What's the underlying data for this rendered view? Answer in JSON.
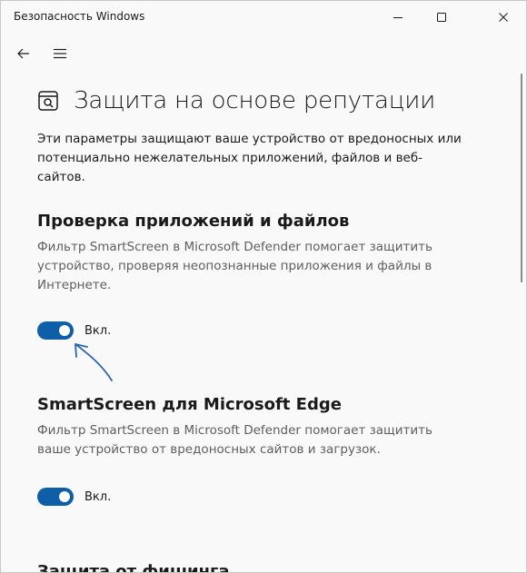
{
  "window": {
    "title": "Безопасность Windows",
    "controls": {
      "minimize": "minimize-icon",
      "maximize": "maximize-icon",
      "close": "close-icon"
    }
  },
  "nav": {
    "back_icon": "back-arrow-icon",
    "menu_icon": "hamburger-menu-icon"
  },
  "page": {
    "icon": "app-browser-control-icon",
    "title": "Защита на основе репутации",
    "description": "Эти параметры защищают ваше устройство от вредоносных или потенциально нежелательных приложений, файлов и веб-сайтов."
  },
  "sections": [
    {
      "title": "Проверка приложений и файлов",
      "description": "Фильтр SmartScreen в Microsoft Defender помогает защитить устройство, проверяя неопознанные приложения и файлы в Интернете.",
      "toggle": {
        "state": "on",
        "label": "Вкл."
      }
    },
    {
      "title": "SmartScreen для Microsoft Edge",
      "description": "Фильтр SmartScreen в Microsoft Defender помогает защитить ваше устройство от вредоносных сайтов и загрузок.",
      "toggle": {
        "state": "on",
        "label": "Вкл."
      }
    },
    {
      "title": "Защита от фишинга"
    }
  ],
  "colors": {
    "accent": "#0f5ea8",
    "annotation_arrow": "#2a66b0",
    "background": "#f9f9f9"
  }
}
